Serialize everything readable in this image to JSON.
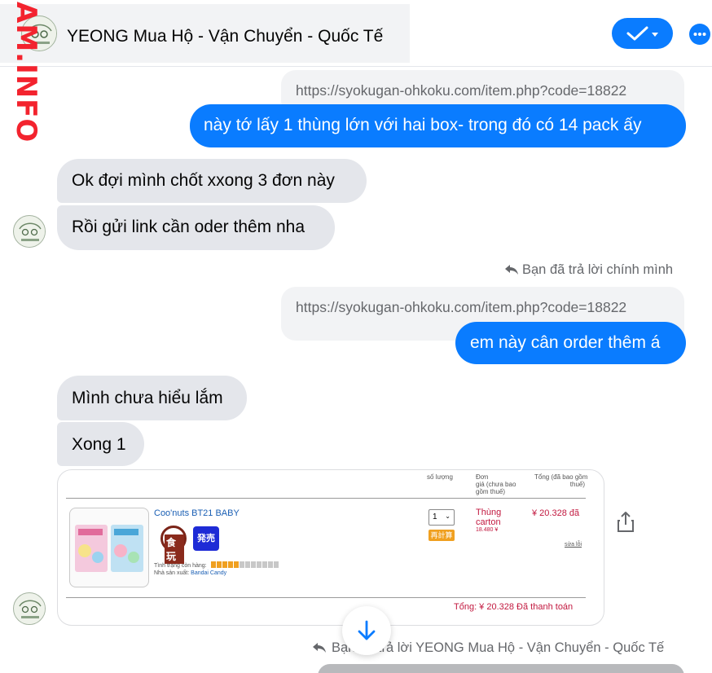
{
  "header": {
    "title": "YEONG Mua Hộ - Vận Chuyển - Quốc Tế",
    "avatar_text": "YEONG",
    "watermark": "AM.INFO",
    "colors": {
      "accent": "#0a7cff",
      "incoming": "#e4e6eb",
      "quote": "#f2f3f5"
    }
  },
  "messages": {
    "q1": "https://syokugan-ohkoku.com/item.php?code=18822",
    "m1": "này tớ lấy 1 thùng lớn với hai box- trong đó có 14 pack ấy",
    "m2": "Ok đợi mình chốt xxong 3 đơn này",
    "m3": "Rồi gửi link cần oder thêm nha",
    "reply_note_1": "Bạn đã trả lời chính mình",
    "q2": "https://syokugan-ohkoku.com/item.php?code=18822",
    "m4": "em này cân order thêm á",
    "m5": "Mình chưa hiểu lắm",
    "m6": "Xong 1",
    "reply_note_2": "Bạn đã trả lời YEONG Mua Hộ - Vận Chuyển - Quốc Tế"
  },
  "card": {
    "col_qty": "số lượng",
    "col_unit_1": "Đơn",
    "col_unit_2": "giá (chưa bao",
    "col_unit_3": "gồm thuế)",
    "col_total_1": "Tổng (đã bao gồm",
    "col_total_2": "thuế)",
    "product_name": "Coo'nuts BT21 BABY",
    "food_badge": "食玩",
    "sale_badge": "発売中",
    "stock_label": "Tình trạng còn hàng:",
    "stock_level": 0.42,
    "maker_label": "Nhà sản xuất:",
    "maker_name": "Bandai Candy",
    "qty_value": "1",
    "recalc": "再計算",
    "unit_name_1": "Thùng",
    "unit_name_2": "carton",
    "unit_price": "18.480 ¥",
    "line_total": "¥ 20.328 đã",
    "remove_link": "sửa lỗi",
    "grand_total": "Tổng: ¥ 20.328 Đã thanh toán"
  }
}
